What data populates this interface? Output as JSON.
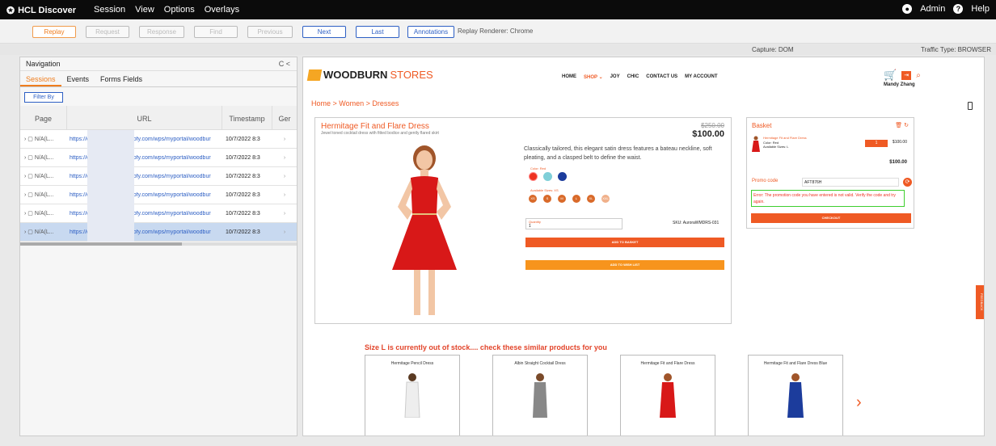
{
  "app": {
    "title": "HCL Discover"
  },
  "menu": [
    "Session",
    "View",
    "Options",
    "Overlays"
  ],
  "user": {
    "name": "Admin",
    "help": "Help"
  },
  "toolbar": {
    "replay": "Replay",
    "request": "Request",
    "response": "Response",
    "find": "Find",
    "previous": "Previous",
    "next": "Next",
    "last": "Last",
    "annotations": "Annotations",
    "renderer": "Replay Renderer: Chrome"
  },
  "subbar": {
    "capture": "Capture: DOM",
    "traffic": "Traffic Type: BROWSER"
  },
  "nav": {
    "title": "Navigation",
    "controls": "C <",
    "tabs": [
      "Sessions",
      "Events",
      "Forms Fields"
    ],
    "filter": "Filter By",
    "columns": [
      "Page",
      "URL",
      "Timestamp",
      "Ger"
    ],
    "rows": [
      {
        "page": "N/A(L...",
        "url1": "https://dx.",
        "url2": "play.hclsofy.com/wps/myportal/woodbur",
        "ts": "10/7/2022 8:3"
      },
      {
        "page": "N/A(L...",
        "url1": "https://dx.",
        "url2": "play.hclsofy.com/wps/myportal/woodbur",
        "ts": "10/7/2022 8:3"
      },
      {
        "page": "N/A(L...",
        "url1": "https://dx.",
        "url2": "play.hclsofy.com/wps/myportal/woodbur",
        "ts": "10/7/2022 8:3"
      },
      {
        "page": "N/A(L...",
        "url1": "https://dx.",
        "url2": "play.hclsofy.com/wps/myportal/woodbur",
        "ts": "10/7/2022 8:3"
      },
      {
        "page": "N/A(L...",
        "url1": "https://dx.",
        "url2": "play.hclsofy.com/wps/myportal/woodbur",
        "ts": "10/7/2022 8:3"
      },
      {
        "page": "N/A(L...",
        "url1": "https://dx.",
        "url2": "play.hclsofy.com/wps/myportal/woodbur",
        "ts": "10/7/2022 8:3"
      }
    ]
  },
  "site": {
    "brand": "WOODBURN",
    "brand2": "STORES",
    "nav": [
      "HOME",
      "SHOP ⌄",
      "JOY",
      "CHIC",
      "CONTACT US",
      "MY ACCOUNT"
    ],
    "user": "Mandy Zhang",
    "crumb": "Home > Women > Dresses",
    "product": {
      "title": "Hermitage Fit and Flare Dress",
      "subtitle": "Jewel toned cocktail dress with fitted bodice and gently flared skirt",
      "old_price": "$250.00",
      "price": "$100.00",
      "desc": "Classically tailored, this elegant satin dress features a bateau neckline, soft pleating, and a clasped belt to define the waist.",
      "color_label": "Color: Red",
      "sizes_label": "Available Sizes: XS",
      "sizes": [
        "XS",
        "S",
        "M",
        "L",
        "XL",
        "XXL"
      ],
      "qty_label": "Quantity",
      "qty": "1",
      "sku": "SKU: AuroraWMDRS-031",
      "add_basket": "ADD TO BASKET",
      "add_wish": "ADD TO WISH LIST"
    },
    "basket": {
      "title": "Basket",
      "item": "Hermitage Fit and Flare Dress",
      "item_color": "Color: Red",
      "item_size": "Available Sizes: L",
      "item_qty": "1",
      "item_price": "$100.00",
      "total": "$100.00",
      "promo_label": "Promo code",
      "promo_value": "AFT876H",
      "error": "Error: The promotion code you have entered is not valid. Verify the code and try again.",
      "checkout": "CHECKOUT"
    },
    "oos": "Size L is currently out of stock.... check these similar products for you",
    "similar": [
      "Hermitage Pencil Dress",
      "Albin Straight Cocktail Dress",
      "Hermitage Fit and Flare Dress",
      "Hermitage Fit and Flare Dress Blue"
    ],
    "feedback": "FEEDBACK"
  },
  "colors": {
    "accent": "#ef5a24",
    "blue": "#2d5fc4",
    "error_border": "#3ecf2f"
  }
}
